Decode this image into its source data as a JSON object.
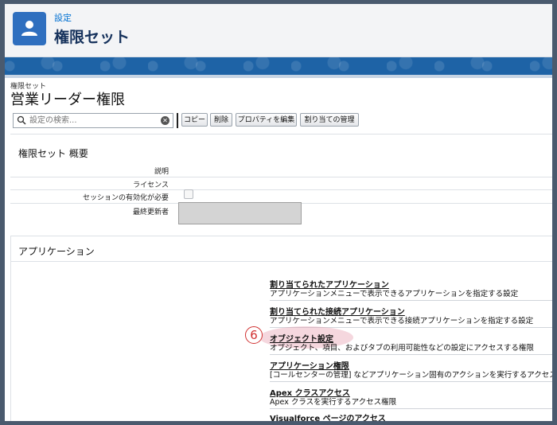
{
  "header": {
    "breadcrumb": "設定",
    "title": "権限セット",
    "app_icon": "user-icon"
  },
  "page": {
    "subtitle": "権限セット",
    "name": "営業リーダー権限"
  },
  "toolbar": {
    "search_placeholder": "設定の検索...",
    "buttons": [
      "コピー",
      "削除",
      "プロパティを編集",
      "割り当ての管理"
    ]
  },
  "overview": {
    "section_title": "権限セット 概要",
    "fields": [
      {
        "label": "説明"
      },
      {
        "label": "ライセンス"
      },
      {
        "label": "セッションの有効化が必要",
        "checked": false
      },
      {
        "label": "最終更新者"
      }
    ]
  },
  "apps": {
    "section_title": "アプリケーション",
    "items": [
      {
        "title": "割り当てられたアプリケーション",
        "desc": "アプリケーションメニューで表示できるアプリケーションを指定する設定"
      },
      {
        "title": "割り当てられた接続アプリケーション",
        "desc": "アプリケーションメニューで表示できる接続アプリケーションを指定する設定"
      },
      {
        "title": "オブジェクト設定",
        "desc": "オブジェクト、項目、およびタブの利用可能性などの設定にアクセスする権限"
      },
      {
        "title": "アプリケーション権限",
        "desc": "[コールセンターの管理] などアプリケーション固有のアクションを実行するアクセス権限"
      },
      {
        "title": "Apex クラスアクセス",
        "desc": "Apex クラスを実行するアクセス権限"
      },
      {
        "title": "Visualforce ページのアクセス",
        "desc": ""
      }
    ],
    "annotation_number": "6"
  },
  "colors": {
    "brand_blue": "#1e63a6",
    "link_blue": "#0070d2",
    "annotation_red": "#d03030"
  }
}
